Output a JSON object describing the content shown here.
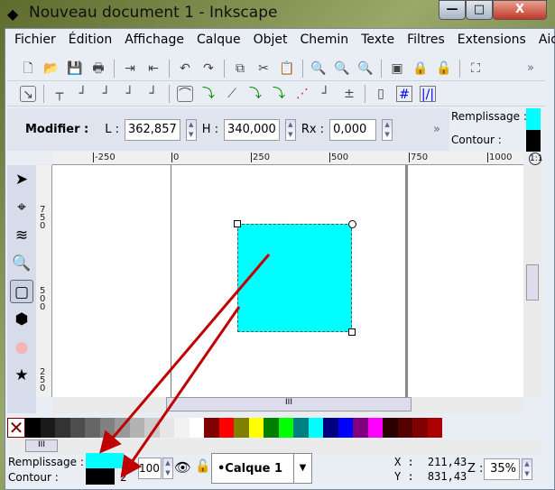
{
  "window": {
    "title": "Nouveau document 1 - Inkscape",
    "minimize": "—",
    "maximize": "□",
    "close": "X"
  },
  "menu": [
    "Fichier",
    "Édition",
    "Affichage",
    "Calque",
    "Objet",
    "Chemin",
    "Texte",
    "Filtres",
    "Extensions",
    "Aide"
  ],
  "toolbar": {
    "commands": [
      "new-icon",
      "open-icon",
      "save-icon",
      "print-icon",
      "import-icon",
      "export-icon",
      "undo-icon",
      "redo-icon",
      "duplicate-icon",
      "cut-icon",
      "paste-icon",
      "zoom-selection-icon",
      "zoom-drawing-icon",
      "zoom-page-icon",
      "group-icon",
      "lock-icon",
      "unlock-icon",
      "zoom-fit-icon"
    ],
    "more": "»"
  },
  "controls": {
    "modifier_label": "Modifier :",
    "width_label": "L :",
    "width_value": "362,857",
    "height_label": "H :",
    "height_value": "340,000",
    "rx_label": "Rx :",
    "rx_value": "0,000",
    "more": "»",
    "fill_label": "Remplissage :",
    "stroke_label": "Contour :"
  },
  "rulers": {
    "h": [
      "-250",
      "0",
      "250",
      "500",
      "750",
      "1000"
    ],
    "v": [
      "750",
      "500",
      "250"
    ]
  },
  "tools": [
    "selector-icon",
    "node-icon",
    "tweak-icon",
    "zoom-icon",
    "rectangle-icon",
    "3d-box-icon",
    "ellipse-icon",
    "star-icon"
  ],
  "palette": [
    "#000000",
    "#1a1a1a",
    "#333333",
    "#4d4d4d",
    "#666666",
    "#808080",
    "#999999",
    "#b3b3b3",
    "#cccccc",
    "#e6e6e6",
    "#f2f2f2",
    "#ffffff",
    "#800000",
    "#ff0000",
    "#808000",
    "#ffff00",
    "#008000",
    "#00ff00",
    "#008080",
    "#00ffff",
    "#000080",
    "#0000ff",
    "#800080",
    "#ff00ff",
    "#2b0000",
    "#550000",
    "#800000",
    "#aa0000"
  ],
  "status": {
    "fill_label": "Remplissage :",
    "stroke_label": "Contour :",
    "fill_color": "#00ffff",
    "stroke_color": "#000000",
    "stroke_width": "2",
    "opacity_label": "O :",
    "opacity_value": "100",
    "layer": "•Calque 1",
    "x_label": "X :",
    "x_value": "211,43",
    "y_label": "Y :",
    "y_value": "831,43",
    "zoom_label": "Z :",
    "zoom_value": "35%"
  },
  "shape": {
    "fill": "#00ffff"
  },
  "arrow_color": "#c00000"
}
